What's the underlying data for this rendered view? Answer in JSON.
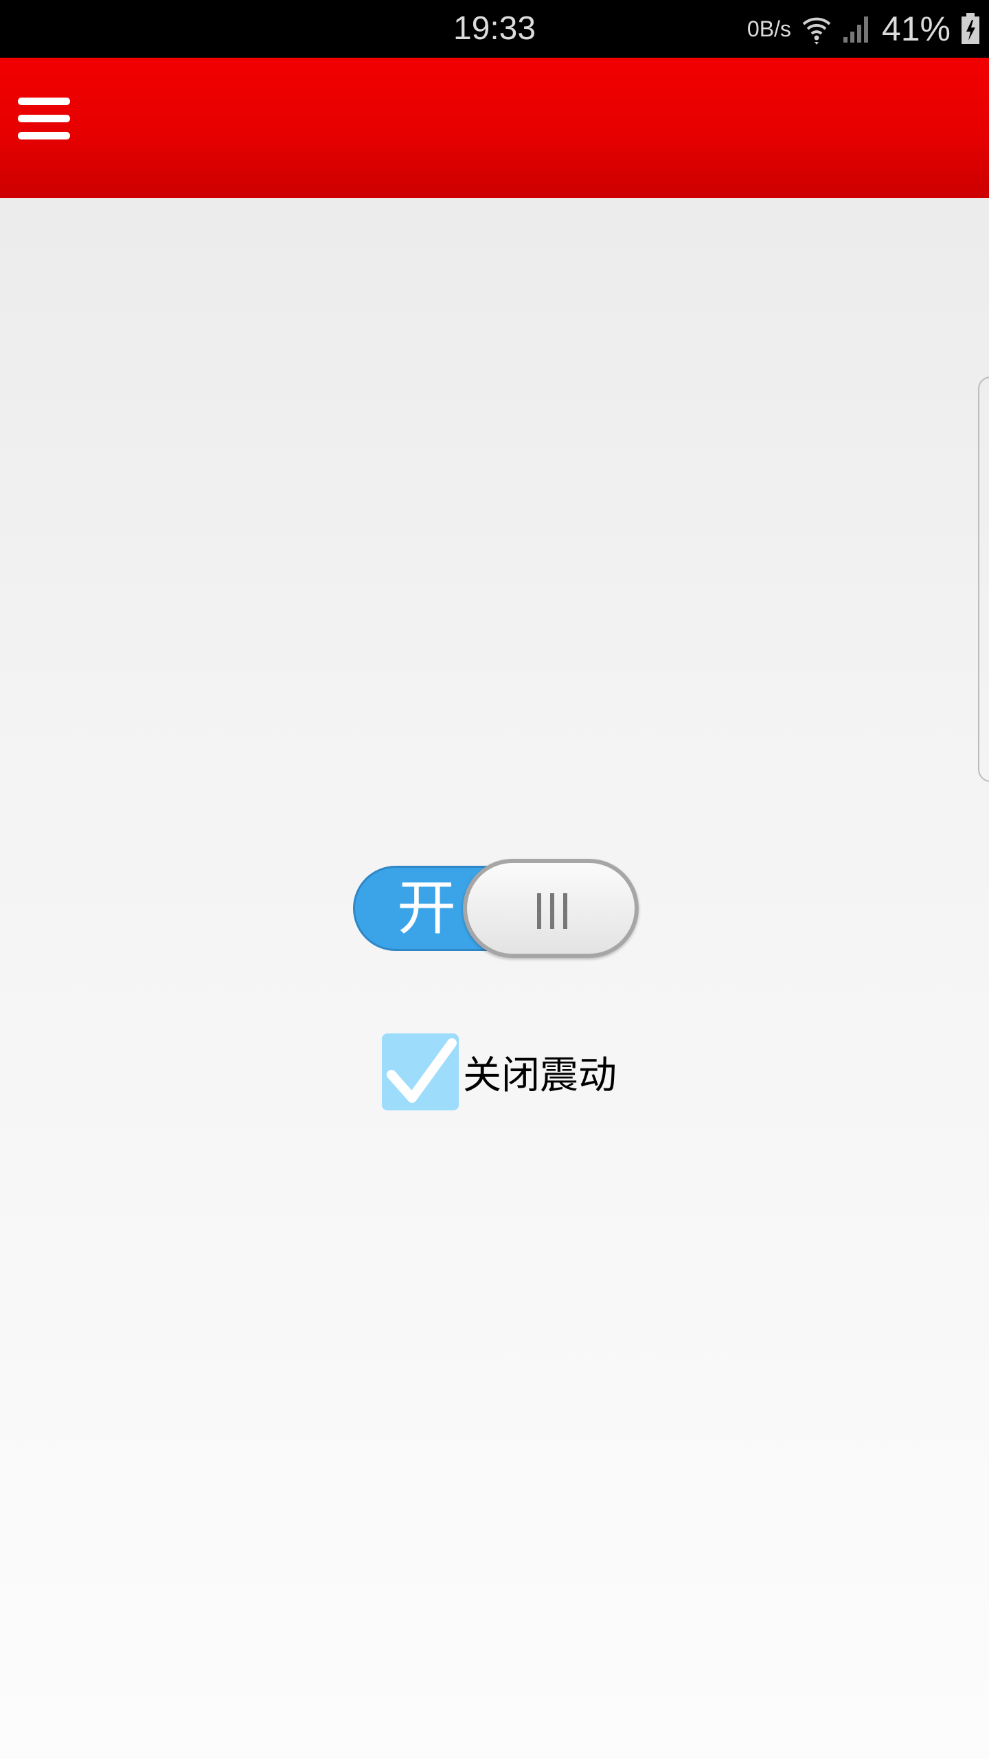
{
  "status_bar": {
    "time": "19:33",
    "net_speed": "0B/s",
    "battery_percent": "41%",
    "icons": [
      "wifi-icon",
      "signal-icon",
      "battery-icon"
    ]
  },
  "toolbar": {
    "menu_icon": "hamburger-menu-icon",
    "color": "#e60000"
  },
  "toggle": {
    "on_label": "开",
    "state": "on",
    "track_color": "#3ba3e8"
  },
  "vibrate": {
    "label": "关闭震动",
    "checked": true,
    "checkbox_color": "#9edcfb"
  }
}
